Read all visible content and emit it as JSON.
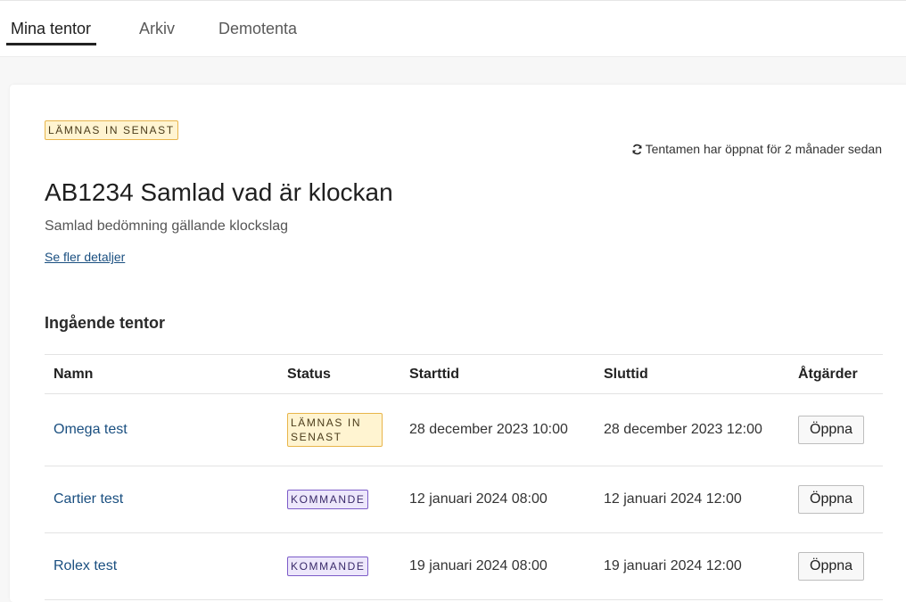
{
  "nav": {
    "tabs": [
      {
        "label": "Mina tentor",
        "active": true
      },
      {
        "label": "Arkiv",
        "active": false
      },
      {
        "label": "Demotenta",
        "active": false
      }
    ]
  },
  "exam": {
    "badge": "LÄMNAS IN SENAST",
    "opened_text": "Tentamen har öppnat för 2 månader sedan",
    "title": "AB1234 Samlad vad är klockan",
    "subtitle": "Samlad bedömning gällande klockslag",
    "details_link": "Se fler detaljer"
  },
  "section_title": "Ingående tentor",
  "table": {
    "headers": [
      "Namn",
      "Status",
      "Starttid",
      "Sluttid",
      "Åtgärder"
    ],
    "rows": [
      {
        "name": "Omega test",
        "status": "LÄMNAS IN SENAST",
        "start": "28 december 2023 10:00",
        "end": "28 december 2023 12:00",
        "action": "Öppna"
      },
      {
        "name": "Cartier test",
        "status": "KOMMANDE",
        "start": "12 januari 2024 08:00",
        "end": "12 januari 2024 12:00",
        "action": "Öppna"
      },
      {
        "name": "Rolex test",
        "status": "KOMMANDE",
        "start": "19 januari 2024 08:00",
        "end": "19 januari 2024 12:00",
        "action": "Öppna"
      }
    ]
  },
  "colors": {
    "link": "#1a4f80",
    "warn_bg": "#fff4d1",
    "warn_border": "#e8b54a",
    "upcoming_bg": "#ede7fb",
    "upcoming_border": "#7c5cc8"
  },
  "icons": {
    "opened": "refresh-icon"
  }
}
